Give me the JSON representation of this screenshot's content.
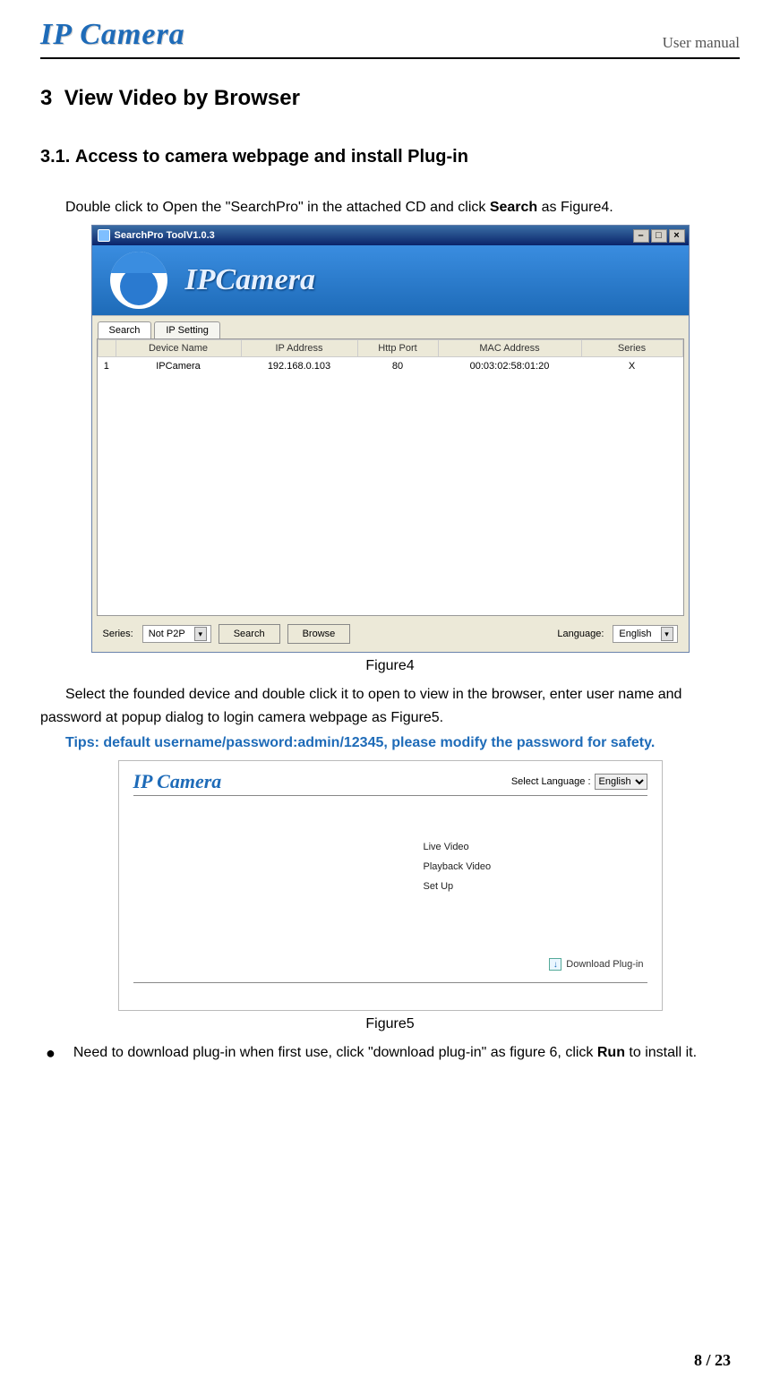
{
  "header": {
    "logo": "IP Camera",
    "doc_title": "User manual"
  },
  "section": {
    "num": "3",
    "title": "View Video by Browser"
  },
  "subsection": {
    "num": "3.1.",
    "title": "Access to camera webpage and install Plug-in"
  },
  "para1_a": "Double click to Open the \"SearchPro\" in the attached CD and click ",
  "para1_b": "Search",
  "para1_c": " as Figure4.",
  "figure4": {
    "titlebar": "SearchPro ToolV1.0.3",
    "brand": "IPCamera",
    "tabs": [
      "Search",
      "IP Setting"
    ],
    "columns": [
      "",
      "Device Name",
      "IP Address",
      "Http Port",
      "MAC Address",
      "Series"
    ],
    "row": {
      "idx": "1",
      "name": "IPCamera",
      "ip": "192.168.0.103",
      "port": "80",
      "mac": "00:03:02:58:01:20",
      "series": "X"
    },
    "bottom": {
      "series_label": "Series:",
      "series_value": "Not P2P",
      "search_btn": "Search",
      "browse_btn": "Browse",
      "lang_label": "Language:",
      "lang_value": "English"
    }
  },
  "caption4": "Figure4",
  "para2": "Select the founded device and double click it to open to view in the browser, enter user name and password at popup dialog to login camera webpage as Figure5.",
  "tip": "Tips: default username/password:admin/12345, please modify the password for safety.",
  "figure5": {
    "logo": "IP Camera",
    "lang_label": "Select Language :",
    "lang_value": "English",
    "links": [
      "Live Video",
      "Playback Video",
      "Set Up"
    ],
    "download": "Download Plug-in"
  },
  "caption5": "Figure5",
  "bullet_a": "Need to download plug-in when first use, click \"download plug-in\" as figure 6, click ",
  "bullet_b": "Run",
  "bullet_c": " to install it.",
  "page_num": "8 / 23"
}
